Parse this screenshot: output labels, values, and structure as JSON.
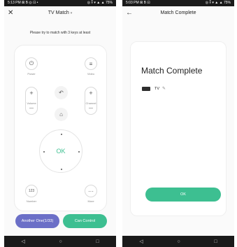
{
  "left": {
    "status": {
      "time": "5:13 PM",
      "left_icons": "⊠ B ◎ ⊡ •",
      "right_icons": "◎ ⁑ ▾ ▲ ▲ 75%"
    },
    "header": {
      "close_glyph": "✕",
      "title": "TV Match",
      "caret": "▾"
    },
    "hint": "Please try to match with 3 keys at least",
    "remote": {
      "power_label": "Power",
      "power_glyph": "⏻",
      "video_label": "Video",
      "video_glyph": "≡",
      "volume_label": "Volume",
      "channel_label": "Channel",
      "plus_glyph": "+",
      "minus_glyph": "—",
      "back_glyph": "↶",
      "home_glyph": "⌂",
      "ok_label": "OK",
      "number_label": "Number",
      "number_glyph": "123",
      "more_label": "More",
      "more_glyph": "···"
    },
    "buttons": {
      "another": "Another One(1/33)",
      "cancel": "Can Control"
    },
    "nav": {
      "back": "◁",
      "home": "○",
      "recent": "□"
    }
  },
  "right": {
    "status": {
      "time": "5:03 PM",
      "left_icons": "⊠ B ⊡",
      "right_icons": "◎ ⁑ ▾ ▲ ▲ 75%"
    },
    "header": {
      "back_glyph": "←",
      "title": "Match Complete"
    },
    "card": {
      "heading": "Match Complete",
      "device_name": "TV",
      "edit_glyph": "✎",
      "ok_button": "OK"
    },
    "nav": {
      "back": "◁",
      "home": "○",
      "recent": "□"
    }
  },
  "colors": {
    "accent_green": "#3dbf91",
    "accent_purple": "#6b6fc7",
    "status_bar": "#1a1a1a"
  },
  "icons": [
    "close-icon",
    "power-icon",
    "video-icon",
    "back-arrow-icon",
    "home-icon",
    "more-icon",
    "tv-icon",
    "edit-icon"
  ]
}
